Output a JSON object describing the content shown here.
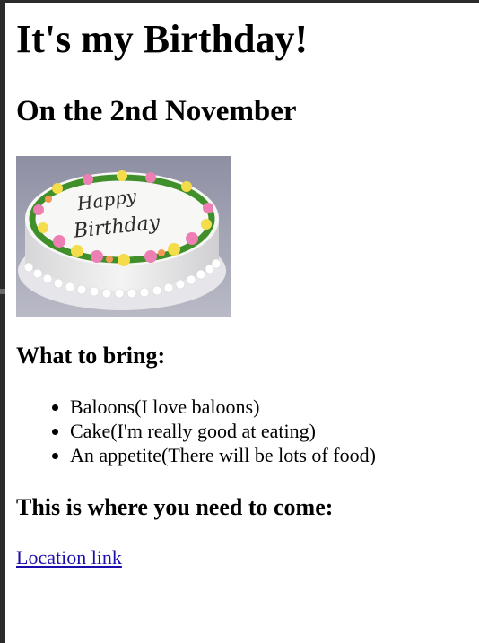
{
  "page": {
    "heading": "It's my Birthday!",
    "subheading": "On the 2nd November"
  },
  "image": {
    "name": "birthday-cake-image",
    "cake_writing_line1": "Happy",
    "cake_writing_line2": "Birthday"
  },
  "bring_section": {
    "heading": "What to bring:",
    "items": [
      "Baloons(I love baloons)",
      "Cake(I'm really good at eating)",
      "An appetite(There will be lots of food)"
    ]
  },
  "location_section": {
    "heading": "This is where you need to come:",
    "link_text": "Location link"
  },
  "colors": {
    "link": "#1a0dab",
    "frame": "#2b2b2b"
  }
}
